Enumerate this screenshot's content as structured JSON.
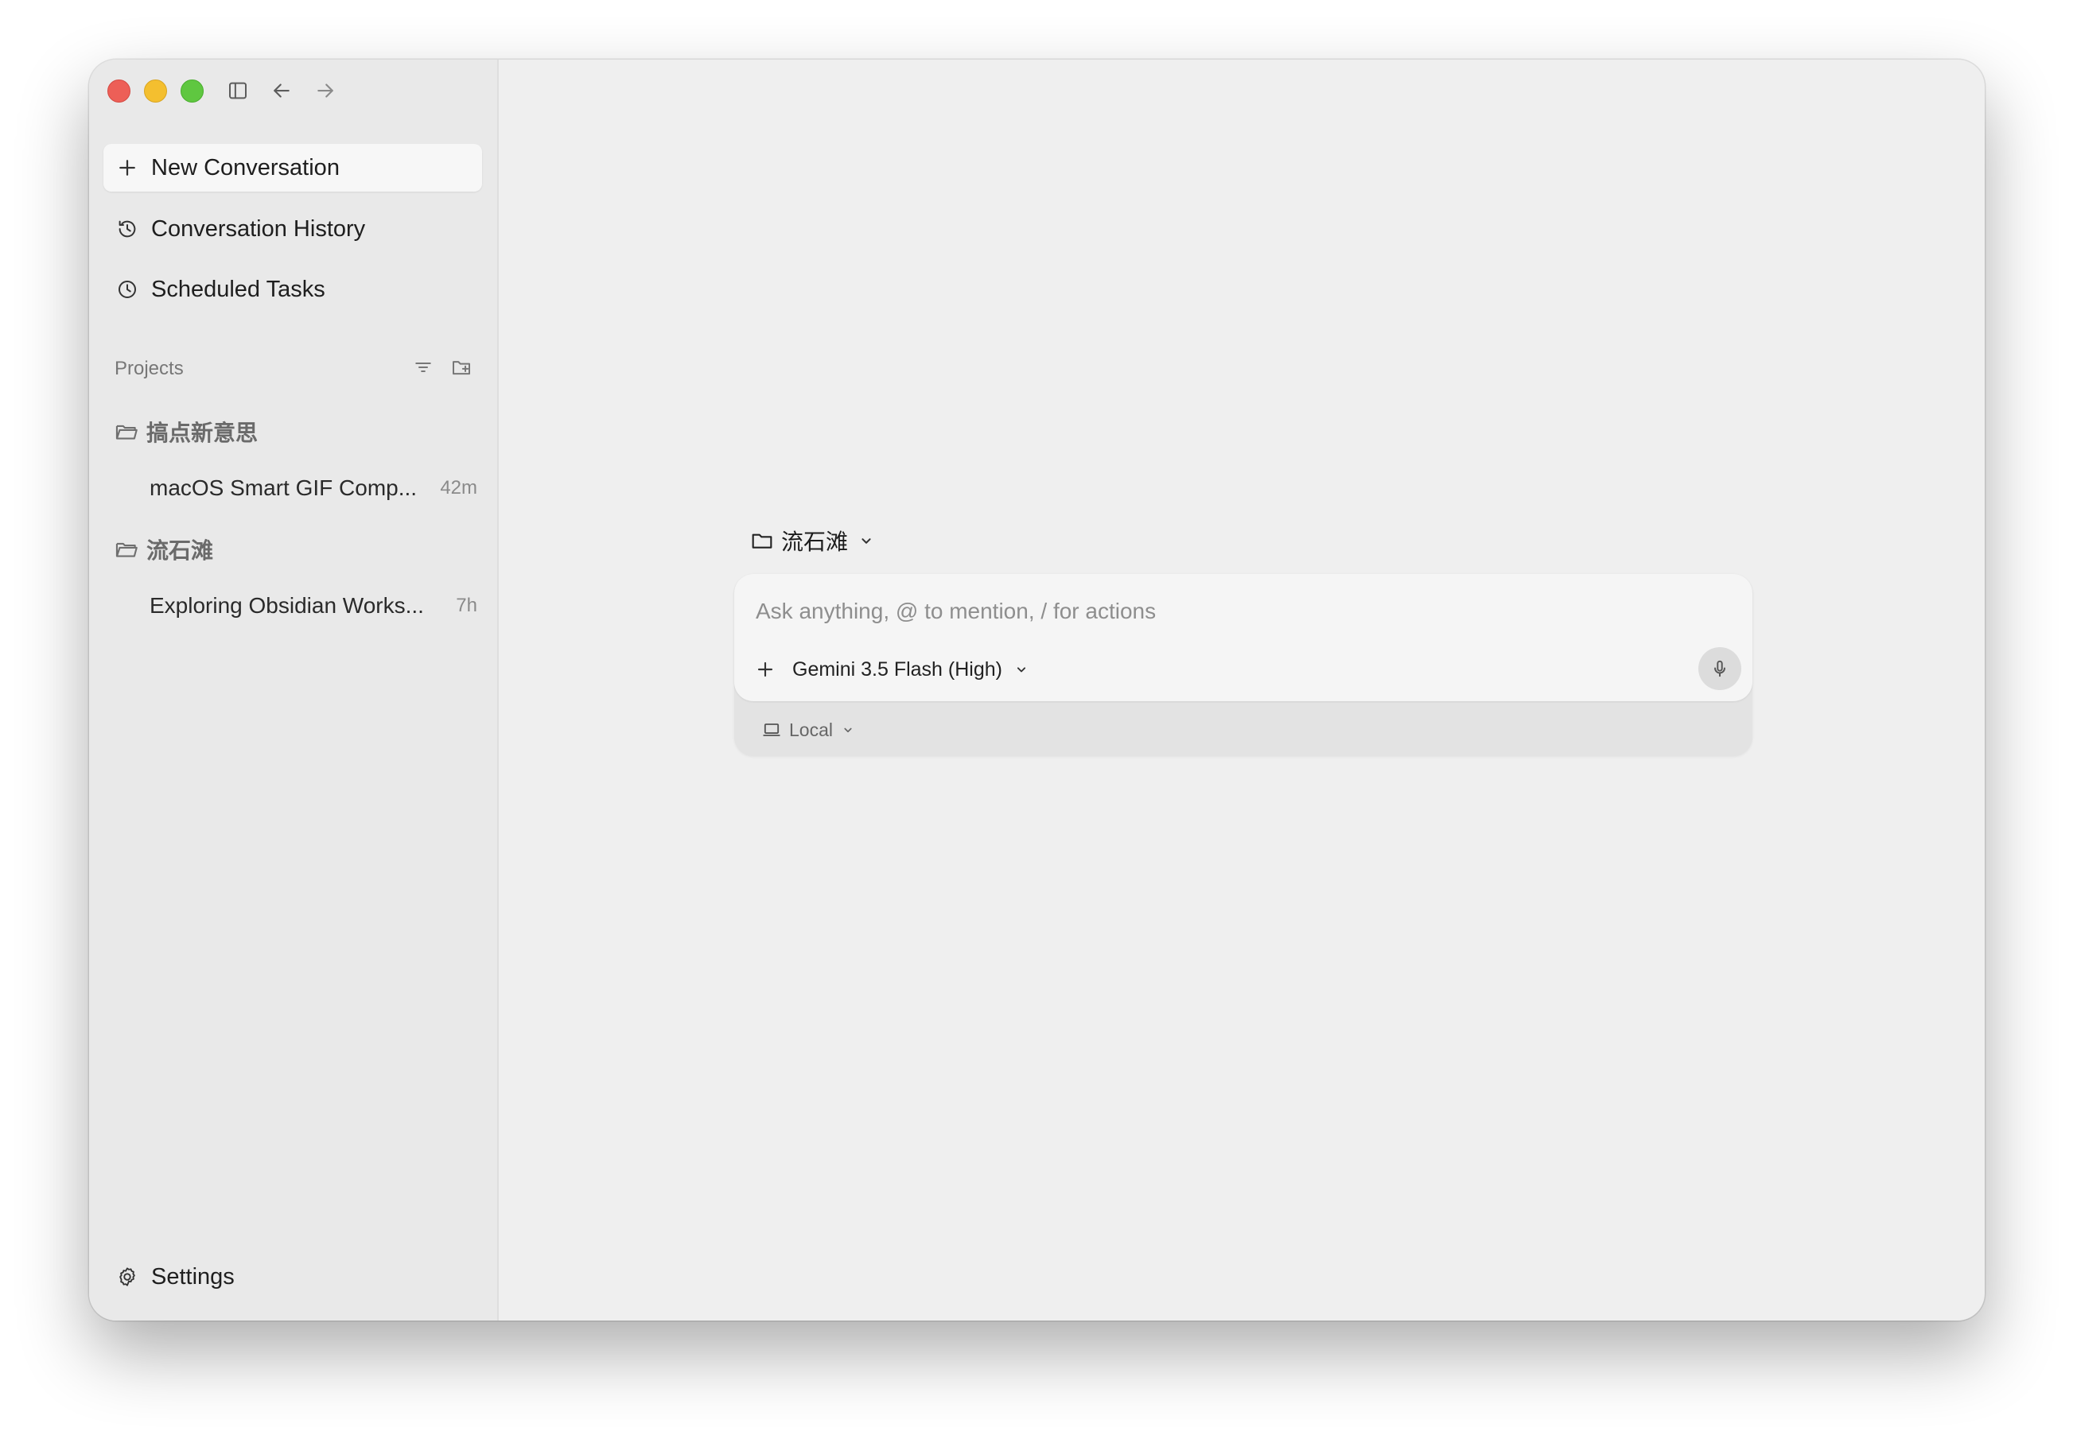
{
  "window": {
    "controls": [
      "close",
      "minimize",
      "zoom"
    ]
  },
  "toolbar": {
    "icons": [
      "sidebar-toggle-icon",
      "back-arrow-icon",
      "forward-arrow-icon"
    ]
  },
  "sidebar": {
    "new_conversation_label": "New Conversation",
    "conversation_history_label": "Conversation History",
    "scheduled_tasks_label": "Scheduled Tasks",
    "projects_header": "Projects",
    "projects": [
      {
        "name": "搞点新意思",
        "conversations": [
          {
            "title": "macOS Smart GIF Comp...",
            "time": "42m"
          }
        ]
      },
      {
        "name": "流石滩",
        "conversations": [
          {
            "title": "Exploring Obsidian Works...",
            "time": "7h"
          }
        ]
      }
    ],
    "settings_label": "Settings"
  },
  "main": {
    "current_project": "流石滩",
    "composer": {
      "placeholder": "Ask anything, @ to mention, / for actions",
      "value": "",
      "model": "Gemini 3.5 Flash (High)",
      "environment": "Local"
    }
  },
  "colors": {
    "window_bg": "#efefef",
    "sidebar_bg": "#e9e9e9",
    "traffic_red": "#ed5f57",
    "traffic_yellow": "#f4bf2f",
    "traffic_green": "#5fc740"
  }
}
